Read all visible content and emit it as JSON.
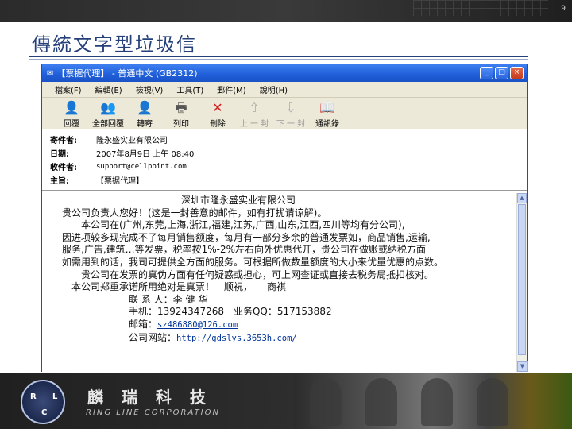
{
  "slide": {
    "number": "9",
    "title": "傳統文字型垃圾信"
  },
  "window": {
    "title": "【票据代理】 - 普通中文 (GB2312)",
    "buttons": [
      "_",
      "□",
      "×"
    ]
  },
  "menu": [
    {
      "label": "檔案(F)"
    },
    {
      "label": "編輯(E)"
    },
    {
      "label": "檢視(V)"
    },
    {
      "label": "工具(T)"
    },
    {
      "label": "郵件(M)"
    },
    {
      "label": "說明(H)"
    }
  ],
  "toolbar": [
    {
      "label": "回覆",
      "icon": "reply-icon",
      "glyph": "👤",
      "enabled": true
    },
    {
      "label": "全部回覆",
      "icon": "reply-all-icon",
      "glyph": "👥",
      "enabled": true
    },
    {
      "label": "轉寄",
      "icon": "forward-icon",
      "glyph": "👤",
      "enabled": true
    },
    {
      "label": "列印",
      "icon": "print-icon",
      "glyph": "🖶",
      "enabled": true
    },
    {
      "label": "刪除",
      "icon": "delete-icon",
      "glyph": "✕",
      "enabled": true
    },
    {
      "label": "上 一 封",
      "icon": "previous-icon",
      "glyph": "⇧",
      "enabled": false
    },
    {
      "label": "下 一 封",
      "icon": "next-icon",
      "glyph": "⇩",
      "enabled": false
    },
    {
      "label": "通訊錄",
      "icon": "address-book-icon",
      "glyph": "📖",
      "enabled": true
    }
  ],
  "headers": {
    "from_label": "寄件者:",
    "from": "隆永盛实业有限公司",
    "date_label": "日期:",
    "date": "2007年8月9日 上午 08:40",
    "to_label": "收件者:",
    "to": "support@cellpoint.com",
    "subject_label": "主旨:",
    "subject": "【票据代理】"
  },
  "body": {
    "company": "深圳市隆永盛实业有限公司",
    "lines": [
      "贵公司负责人您好！(这是一封善意的邮件，如有打扰请谅解)。",
      "　　本公司在(广州,东莞,上海,浙江,福建,江苏,广西,山东,江西,四川等均有分公司),",
      "因进项较多现完成不了每月销售额度，每月有一部分多余的普通发票如，商品销售,运输,",
      "服务,广告,建筑…等发票，税率按1%-2%左右向外优惠代开，贵公司在做账或纳税方面",
      "如需用到的话，我司可提供全方面的服务。可根据所做数量额度的大小来优量优惠的点数。",
      "　　贵公司在发票的真伪方面有任何疑惑或担心，可上网查证或直接去税务局抵扣核对。",
      "　本公司郑重承诺所用绝对是真票！　顺祝，　　商祺"
    ],
    "contact": "　　　　　　　联 系 人：李 健 华",
    "mobile": "　　　　　　　手机：13924347268　业务QQ：517153882",
    "email_label": "　　　　　　　邮箱：",
    "email": "sz486880@126.com",
    "site_label": "　　　　　　　公司网站：",
    "site": "http://gdslys.3653h.com/"
  },
  "footer": {
    "logo_letters": [
      "R",
      "L",
      "C"
    ],
    "brand_cn": "麟 瑞 科 技",
    "brand_en": "RING LINE CORPORATION"
  }
}
